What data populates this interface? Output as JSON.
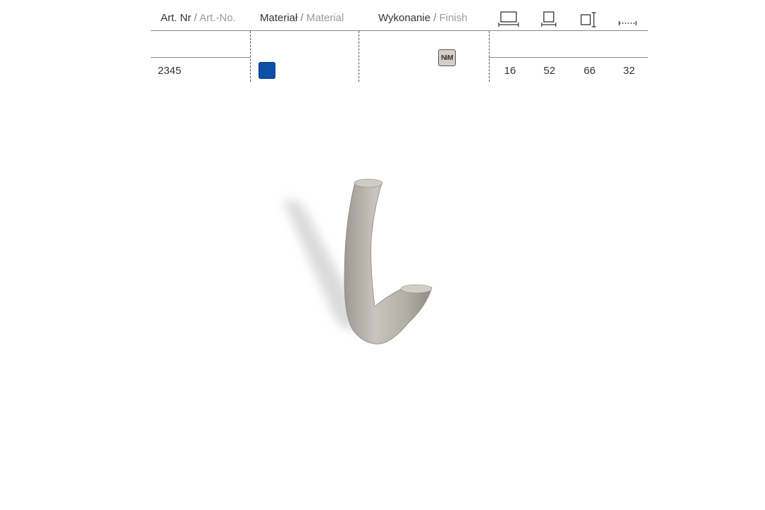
{
  "table": {
    "headers": {
      "art_nr": {
        "primary": "Art. Nr",
        "separator": " / ",
        "secondary": "Art.-No."
      },
      "material": {
        "primary": "Materiał",
        "separator": " / ",
        "secondary": "Material"
      },
      "finish": {
        "primary": "Wykonanie",
        "separator": " / ",
        "secondary": "Finish"
      },
      "dimension_icons": [
        "length-dimension-icon",
        "width-dimension-icon",
        "height-dimension-icon",
        "spacing-dimension-icon"
      ]
    },
    "row": {
      "art_nr": "2345",
      "material_color": "#0d4fa8",
      "finish_code": "NiM",
      "dimensions": [
        "16",
        "52",
        "66",
        "32"
      ]
    }
  },
  "product": {
    "icon": "wall-hook-image",
    "finish_color": "#b8b4ad"
  }
}
